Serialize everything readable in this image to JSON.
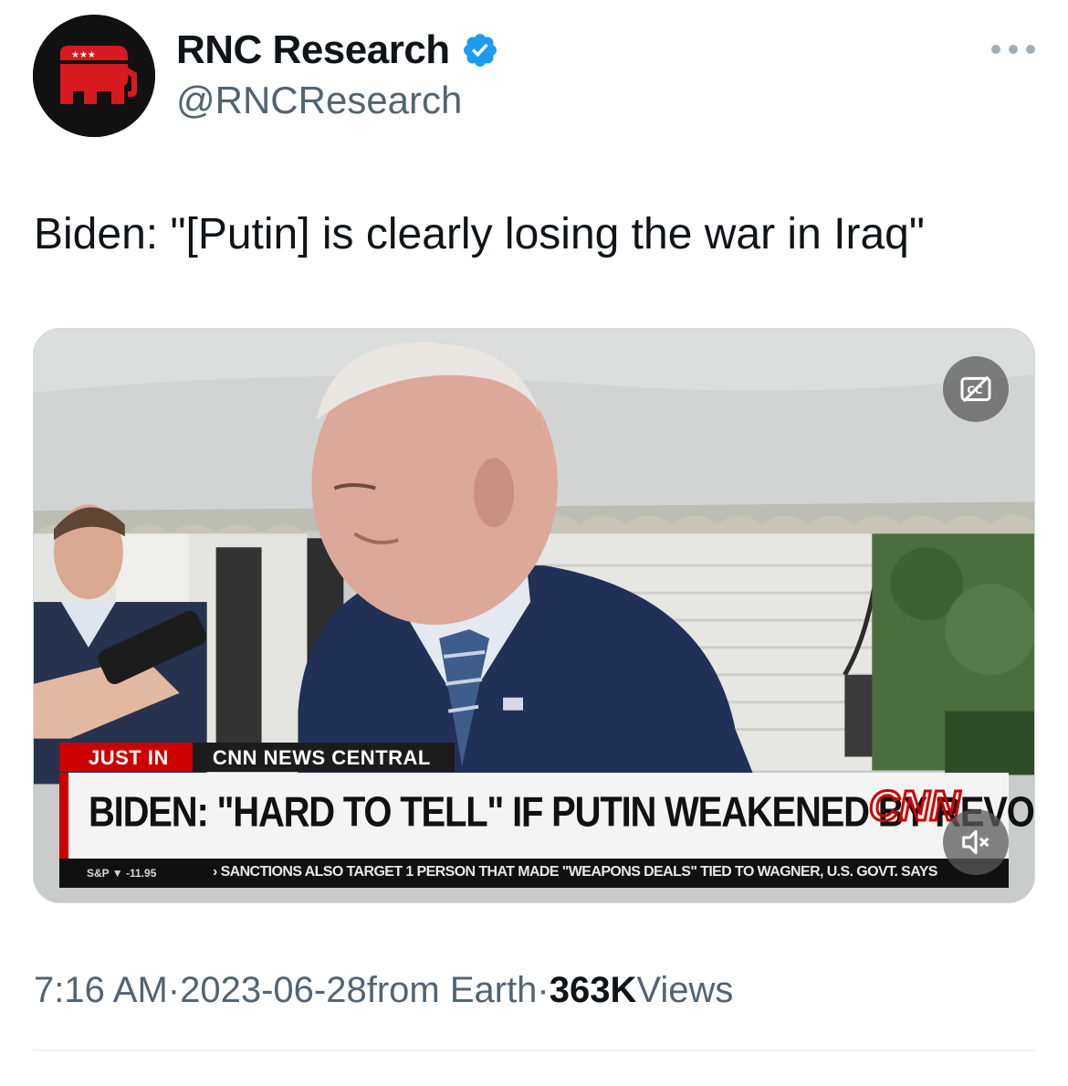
{
  "author": {
    "name": "RNC Research",
    "handle": "@RNCResearch",
    "verified": true,
    "avatar_icon": "republican-elephant-icon"
  },
  "tweet": {
    "text": "Biden: \"[Putin] is clearly losing the war in Iraq\""
  },
  "media": {
    "type": "video",
    "chyron": {
      "badge": "JUST IN",
      "program": "CNN NEWS CENTRAL",
      "headline": "BIDEN: \"HARD TO TELL\" IF PUTIN WEAKENED BY REVOLT",
      "network_logo": "CNN",
      "ticker_stock": "S&P ▼ -11.95",
      "ticker_text": "› SANCTIONS ALSO TARGET 1 PERSON THAT MADE \"WEAPONS DEALS\" TIED TO WAGNER, U.S. GOVT. SAYS"
    },
    "controls": {
      "captions_icon": "closed-captions-off-icon",
      "mute_icon": "muted-speaker-icon"
    }
  },
  "footer": {
    "time": "7:16 AM",
    "separator": " · ",
    "date": "2023-06-28",
    "source": " from Earth",
    "views_count": "363K",
    "views_label": " Views"
  },
  "colors": {
    "text_primary": "#0f1419",
    "text_secondary": "#536471",
    "verified_blue": "#1d9bf0",
    "cnn_red": "#cc0000"
  }
}
